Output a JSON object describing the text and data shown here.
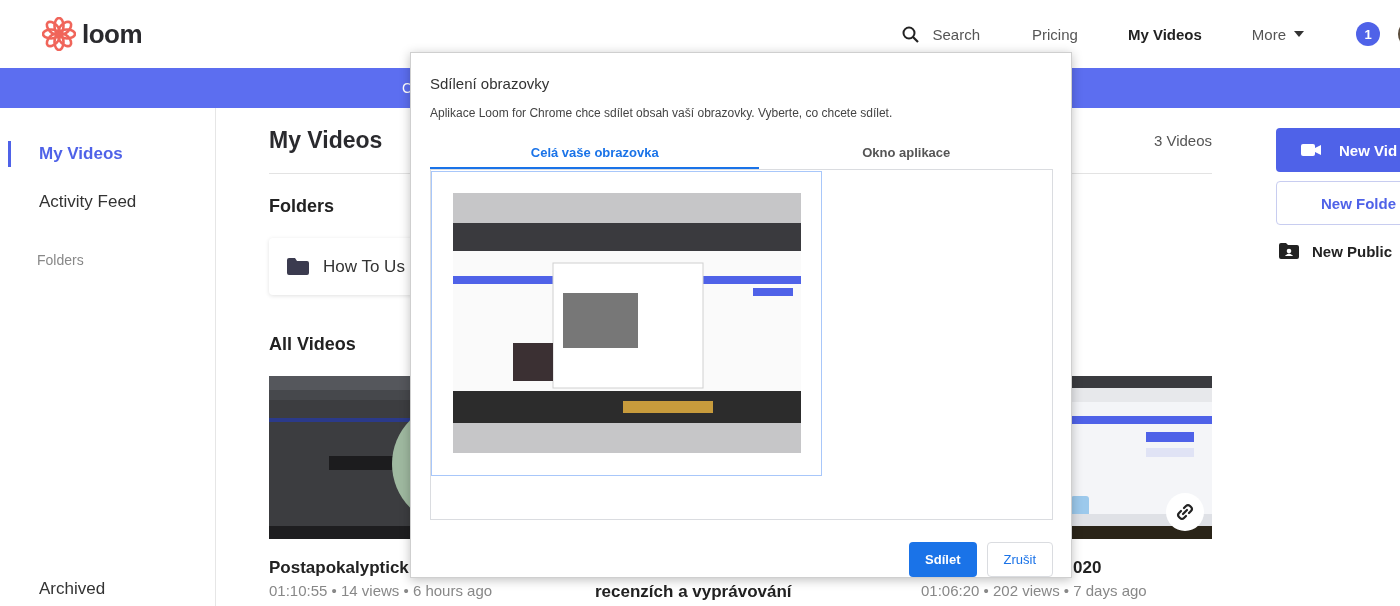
{
  "header": {
    "logo": "loom",
    "nav": [
      {
        "kind": "search",
        "label": "Search"
      },
      {
        "kind": "link",
        "label": "Pricing",
        "selected": false
      },
      {
        "kind": "link",
        "label": "My Videos",
        "selected": true
      },
      {
        "kind": "menu",
        "label": "More"
      }
    ],
    "notification_count": "1"
  },
  "banner": {
    "text": "C"
  },
  "sidebar": {
    "items": [
      {
        "label": "My Videos",
        "selected": true
      },
      {
        "label": "Activity Feed",
        "selected": false
      }
    ],
    "section_label": "Folders",
    "bottom_item": "Archived"
  },
  "main": {
    "title": "My Videos",
    "count": "3 Videos",
    "folders_heading": "Folders",
    "folders": [
      {
        "name": "How To Us"
      }
    ],
    "videos_heading": "All Videos",
    "videos": [
      {
        "title": "Postapokalyptick",
        "meta": "01:10:55 • 14 views • 6 hours ago",
        "thumb": {
          "kind": "picture"
        }
      },
      {
        "title": "recenzích a vyprávování"
      },
      {
        "title": "020",
        "meta": "01:06:20 • 202 views • 7 days ago",
        "thumb": {
          "kind": "picture"
        },
        "link_button": true
      }
    ]
  },
  "actions": [
    {
      "kind": "primary",
      "label": "New Vid"
    },
    {
      "kind": "outline",
      "label": "New Folde"
    },
    {
      "kind": "link",
      "label": "New Public"
    }
  ],
  "dialog": {
    "title": "Sdílení obrazovky",
    "description": "Aplikace Loom for Chrome chce sdílet obsah vaší obrazovky. Vyberte, co chcete sdílet.",
    "tabs": [
      {
        "label": "Celá vaše obrazovka",
        "selected": true
      },
      {
        "label": "Okno aplikace",
        "selected": false
      }
    ],
    "sources": [
      {
        "kind": "picture",
        "selected": true
      }
    ],
    "buttons": [
      {
        "kind": "primary",
        "label": "Sdílet"
      },
      {
        "kind": "secondary",
        "label": "Zrušit"
      }
    ]
  }
}
